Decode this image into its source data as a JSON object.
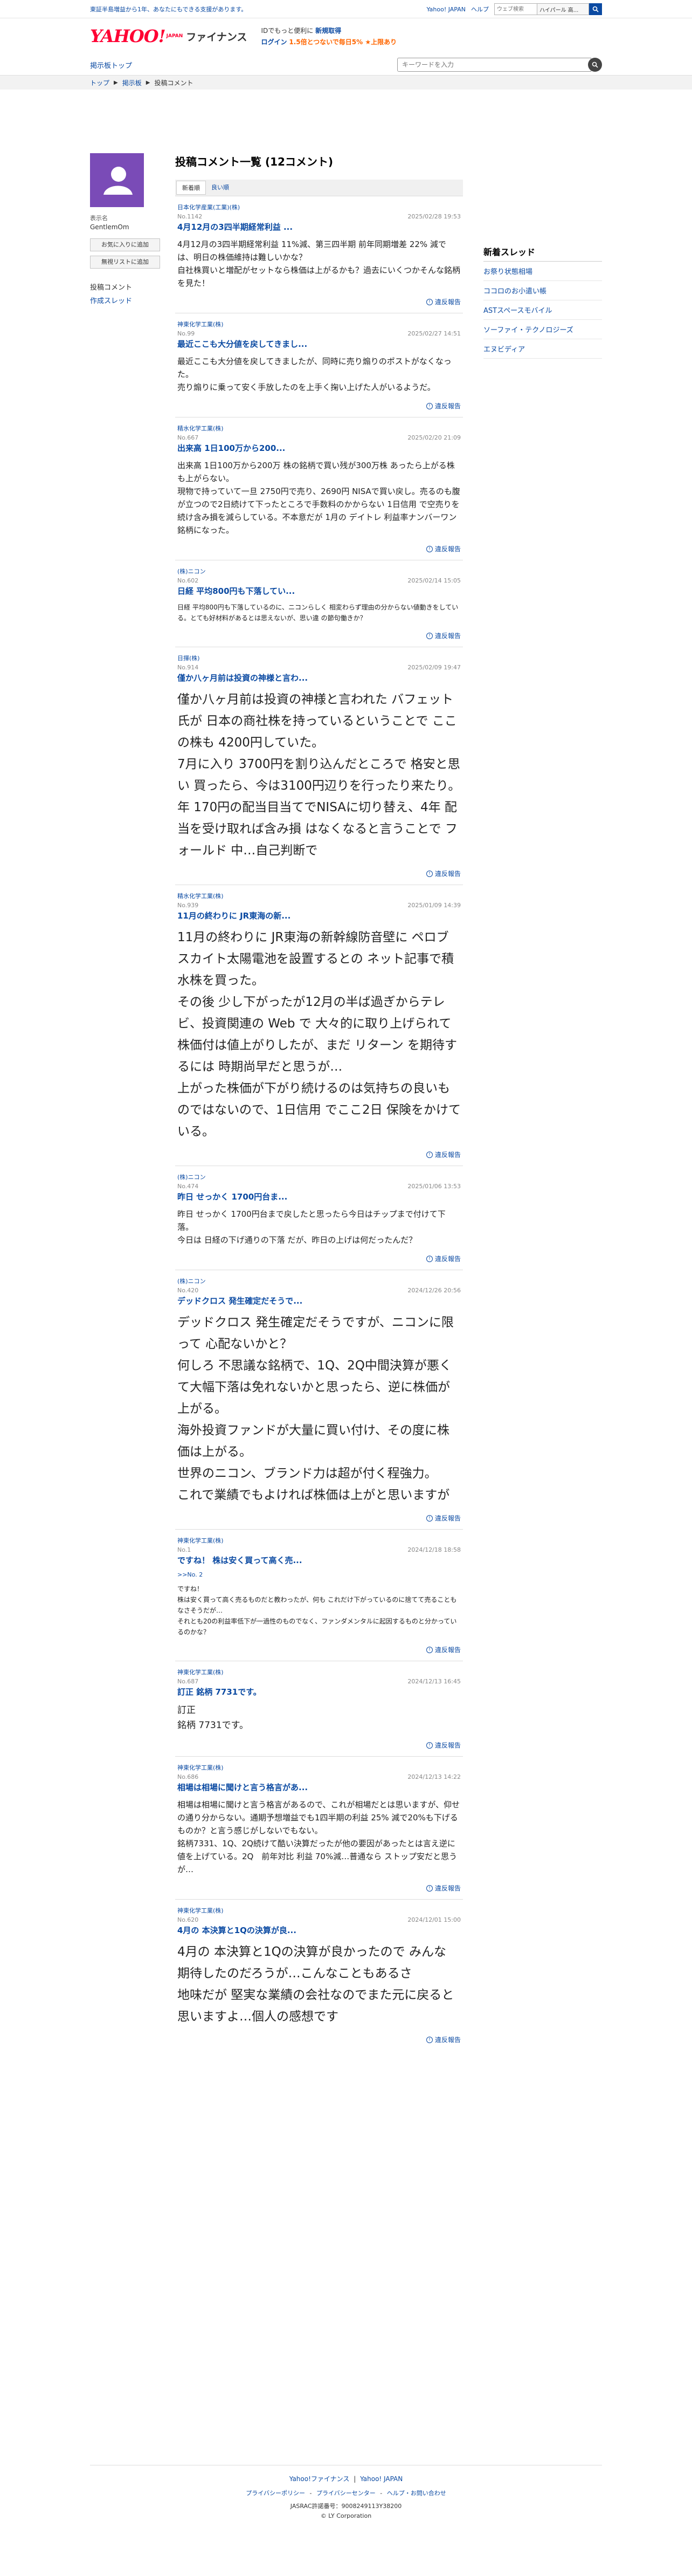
{
  "top": {
    "notice": "東証半島増益から1年、あなたにもできる支援があります。",
    "yahoo_japan": "Yahoo! JAPAN",
    "help": "ヘルプ",
    "search_placeholder": "ウェブ検索",
    "search_select": "ハイパール 高...",
    "search_icon": "search-icon"
  },
  "header": {
    "logo_main": "YAHOO!",
    "logo_sub": "JAPAN",
    "logo_finance": "ファイナンス",
    "promo_line1_prefix": "IDでもっと便利に",
    "promo_line1_link": "新規取得",
    "promo_line2_login": "ログイン",
    "promo_line2_pay": "1.5倍とつないで毎日5% ★上限あり"
  },
  "board": {
    "home": "掲示板トップ",
    "search_placeholder": "キーワードを入力"
  },
  "breadcrumb": [
    "トップ",
    "掲示板",
    "投稿コメント"
  ],
  "user": {
    "meta_label": "表示名",
    "name": "GentlemOm",
    "btn_favorite": "お気に入りに追加",
    "btn_block": "無視リストに追加",
    "nav_comments": "投稿コメント",
    "nav_threads": "作成スレッド"
  },
  "main": {
    "title": "投稿コメント一覧 (12コメント)",
    "tab_new": "新着順",
    "tab_likes": "良い順",
    "report_label": "違反報告"
  },
  "comments": [
    {
      "stock": "日本化学産業(工業)(株)",
      "no": "No.1142",
      "date": "2025/02/28 19:53",
      "title": "4月12月の3四半期経常利益 ...",
      "body": "4月12月の3四半期経常利益 11%減、第三四半期 前年同期増差 22% 減では、明日の株価維持は難しいかな？\n自社株買いと増配がセットなら株価は上がるかも？過去にいくつかそんな銘柄を見た！",
      "size": "m"
    },
    {
      "stock": "神東化学工業(株)",
      "no": "No.99",
      "date": "2025/02/27 14:51",
      "title": "最近ここも大分値を戻してきまし...",
      "body": "最近ここも大分値を戻してきましたが、同時に売り煽りのポストがなくなった。\n売り煽りに乗って安く手放したのを上手く掬い上げた人がいるようだ。",
      "size": "m"
    },
    {
      "stock": "精水化学工業(株)",
      "no": "No.667",
      "date": "2025/02/20 21:09",
      "title": "出来高 1日100万から200...",
      "body": "出来高 1日100万から200万 株の銘柄で買い残が300万株 あったら上がる株も上がらない。\n現物で持っていて一旦 2750円で売り、2690円 NISAで買い戻し。売るのも腹が立つので2日続けて下ったところで手数料のかからない 1日信用 で空売りを続け含み損を減らしている。不本意だが 1月の デイトレ 利益率ナンバーワン 銘柄になった。",
      "size": "m"
    },
    {
      "stock": "(株)ニコン",
      "no": "No.602",
      "date": "2025/02/14 15:05",
      "title": "日経 平均800円も下落してい...",
      "body": "日経 平均800円も下落しているのに、ニコンらしく 相変わらず理由の分からない値動きをしている。とても好材料があるとは思えないが、思い違 の節句働きか？",
      "size": "xs"
    },
    {
      "stock": "日揮(株)",
      "no": "No.914",
      "date": "2025/02/09 19:47",
      "title": "僅か八ヶ月前は投資の神様と言わ...",
      "body": "僅か八ヶ月前は投資の神様と言われた バフェット氏が 日本の商社株を持っているということで ここの株も 4200円していた。\n7月に入り 3700円を割り込んだところで 格安と思い 買ったら、今は3100円辺りを行ったり来たり。年 170円の配当目当てでNISAに切り替え、4年 配当を受け取れば含み損 はなくなると言うことで フォールド 中…自己判断で",
      "size": "l"
    },
    {
      "stock": "精水化学工業(株)",
      "no": "No.939",
      "date": "2025/01/09 14:39",
      "title": "11月の終わりに JR東海の新...",
      "body": "11月の終わりに JR東海の新幹線防音壁に ペロブスカイト太陽電池を設置するとの ネット記事で積水株を買った。\nその後 少し下がったが12月の半ば過ぎからテレビ、投資関連の Web で 大々的に取り上げられて株価付は値上がりしたが、まだ リターン を期待するには 時期尚早だと思うが…\n上がった株価が下がり続けるのは気持ちの良いものではないので、1日信用 でここ2日 保険をかけている。",
      "size": "l"
    },
    {
      "stock": "(株)ニコン",
      "no": "No.474",
      "date": "2025/01/06 13:53",
      "title": "昨日 せっかく 1700円台ま...",
      "body": "昨日 せっかく 1700円台まで戻したと思ったら今日はチップまで付けて下落。\n今日は 日経の下げ通りの下落 だが、昨日の上げは何だったんだ？",
      "size": "m"
    },
    {
      "stock": "(株)ニコン",
      "no": "No.420",
      "date": "2024/12/26 20:56",
      "title": "デッドクロス 発生確定だそうで...",
      "body": "デッドクロス 発生確定だそうですが、ニコンに限って 心配ないかと？\n何しろ 不思議な銘柄で、1Q、2Q中間決算が悪くて大幅下落は免れないかと思ったら、逆に株価が上がる。\n海外投資ファンドが大量に買い付け、その度に株価は上がる。\n世界のニコン、ブランド力は超が付く程強力。\nこれで業績でもよければ株価は上がと思いますが",
      "size": "l"
    },
    {
      "stock": "神東化学工業(株)",
      "no": "No.1",
      "date": "2024/12/18 18:58",
      "title": "ですね！ 株は安く買って高く売...",
      "reply": ">>No. 2",
      "body": "ですね！\n株は安く買って高く売るものだと教わったが、何も これだけ下がっているのに捨てて売ることも なさそうだが…\nそれとも20の利益率低下が一過性のものでなく、ファンダメンタルに起因するものと分かっているのかな？",
      "size": "xs"
    },
    {
      "stock": "神東化学工業(株)",
      "no": "No.687",
      "date": "2024/12/13 16:45",
      "title": "訂正 銘柄 7731です。",
      "body": "訂正\n銘柄 7731です。",
      "size": "s"
    },
    {
      "stock": "神東化学工業(株)",
      "no": "No.686",
      "date": "2024/12/13 14:22",
      "title": "相場は相場に聞けと言う格言があ...",
      "body": "相場は相場に聞けと言う格言があるので、これが相場だとは思いますが、仰せの通り分からない。通期予想増益でも1四半期の利益 25% 減で20%も下げるものか？と言う感じがしないでもない。\n銘柄7331、1Q、2Q続けて酷い決算だったが他の要因があったとは言え逆に値を上げている。2Q　前年対比 利益 70%減…普通なら ストップ安だと思うが…",
      "size": "m"
    },
    {
      "stock": "神東化学工業(株)",
      "no": "No.620",
      "date": "2024/12/01 15:00",
      "title": "4月の 本決算と1Qの決算が良...",
      "body": "4月の 本決算と1Qの決算が良かったので みんな 期待したのだろうが…こんなこともあるさ\n地味だが 堅実な業績の会社なのでまた元に戻ると思いますよ…個人の感想です",
      "size": "l"
    }
  ],
  "right": {
    "title": "新着スレッド",
    "items": [
      "お祭り状態相場",
      "ココロのお小遣い帳",
      "ASTスペースモバイル",
      "ソーファイ・テクノロジーズ",
      "エヌビディア"
    ]
  },
  "footer": {
    "links1": [
      "Yahoo!ファイナンス",
      "Yahoo! JAPAN"
    ],
    "links2": [
      "プライバシーポリシー",
      "プライバシーセンター",
      "ヘルプ・お問い合わせ"
    ],
    "reg": "JASRAC許諾番号：9008249113Y38200",
    "copyright": "© LY Corporation"
  },
  "colors": {
    "link": "#0b4aa2",
    "logo_red": "#ff0033",
    "avatar_purple": "#7a4bb7"
  }
}
